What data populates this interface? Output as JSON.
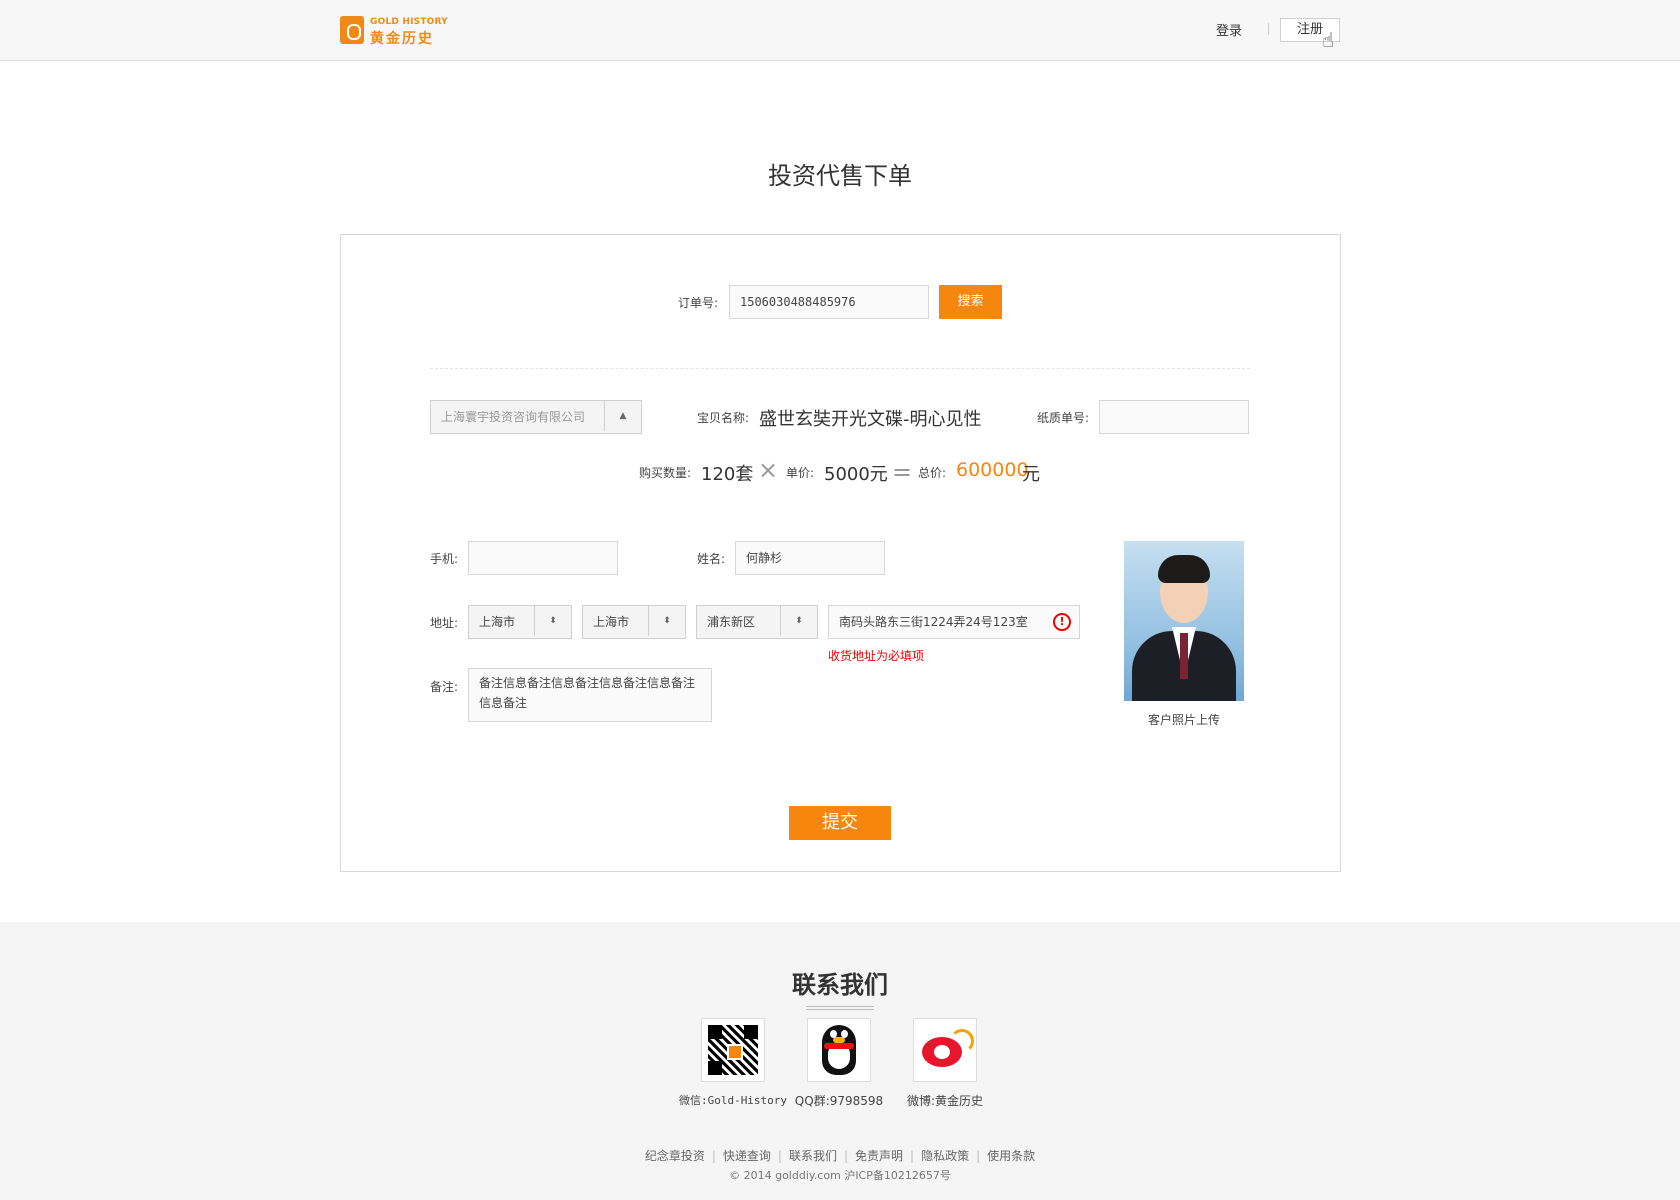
{
  "header": {
    "logo_en": "GOLD HISTORY",
    "logo_cn": "黄金历史",
    "login": "登录",
    "register": "注册"
  },
  "page_title": "投资代售下单",
  "order": {
    "label": "订单号:",
    "value": "1506030488485976",
    "search_label": "搜索"
  },
  "company_select": {
    "value": "上海寰宇投资咨询有限公司"
  },
  "item": {
    "label": "宝贝名称:",
    "value": "盛世玄奘开光文碟-明心见性"
  },
  "paper": {
    "label": "纸质单号:",
    "value": ""
  },
  "calc": {
    "qty_label": "购买数量:",
    "qty_value": "120套",
    "times": "×",
    "price_label": "单价:",
    "price_value": "5000元",
    "equals": "=",
    "total_label": "总价:",
    "total_value": "600000",
    "total_unit": "元"
  },
  "phone": {
    "label": "手机:",
    "value": ""
  },
  "name": {
    "label": "姓名:",
    "value": "何静杉"
  },
  "address": {
    "label": "地址:",
    "province": "上海市",
    "city": "上海市",
    "district": "浦东新区",
    "detail": "南码头路东三街1224弄24号123室",
    "error_icon": "!",
    "error_text": "收货地址为必填项"
  },
  "note": {
    "label": "备注:",
    "value": "备注信息备注信息备注信息备注信息备注信息备注"
  },
  "photo": {
    "label": "客户照片上传"
  },
  "submit_label": "提交",
  "footer": {
    "contact_title": "联系我们",
    "wechat": "微信:Gold-History",
    "qq": "QQ群:9798598",
    "weibo": "微博:黄金历史",
    "links": [
      "纪念章投资",
      "快递查询",
      "联系我们",
      "免责声明",
      "隐私政策",
      "使用条款"
    ],
    "copyright": "© 2014 golddiy.com 沪ICP备10212657号"
  },
  "colors": {
    "accent": "#f7860f",
    "error": "#e00000"
  }
}
